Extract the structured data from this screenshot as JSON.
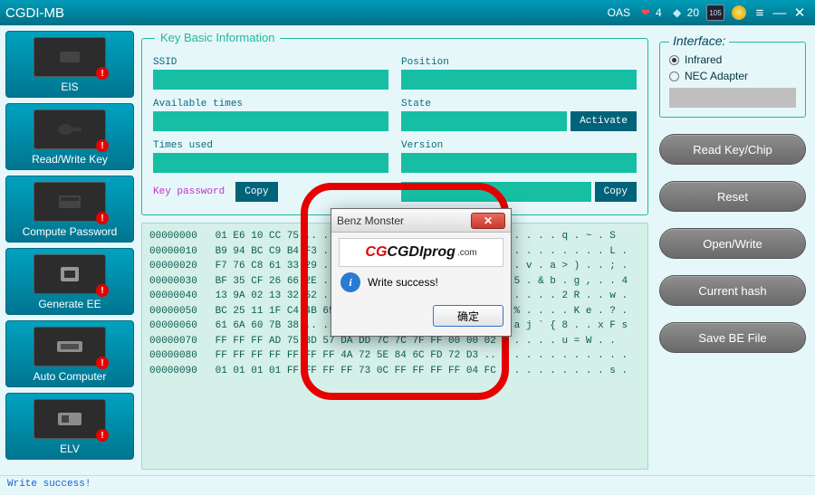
{
  "titlebar": {
    "app": "CGDI-MB",
    "oas": "OAS",
    "heart_count": "4",
    "diamond_count": "20",
    "chip_label": "105"
  },
  "sidebar": {
    "items": [
      {
        "label": "EIS"
      },
      {
        "label": "Read/Write Key"
      },
      {
        "label": "Compute Password"
      },
      {
        "label": "Generate EE"
      },
      {
        "label": "Auto Computer"
      },
      {
        "label": "ELV"
      }
    ]
  },
  "kbi": {
    "title": "Key Basic Information",
    "ssid_lbl": "SSID",
    "position_lbl": "Position",
    "avail_lbl": "Available times",
    "state_lbl": "State",
    "activate_btn": "Activate",
    "times_lbl": "Times used",
    "version_lbl": "Version",
    "keypw_lbl": "Key password",
    "copy_btn": "Copy"
  },
  "hex": {
    "lines": [
      "00000000   01 E6 10 CC 75 .. .. .. .. .. .. .. .. .. .. ..   . . . . q . ~ . S",
      "00000010   B9 94 BC C9 B4 F3 .. .. .. .. .. .. .. .. .. ..   . . . . . . . . L .",
      "00000020   F7 76 C8 61 33 29 .. .. .. .. .. .. .. .. .. ..   . v . a > ) . . ; .",
      "00000030   BF 35 CF 26 66 2E .. .. .. .. .. .. .. .. .. ..   5 . & b . g , . . 4",
      "00000040   13 9A 02 13 32 52 .. .. .. .. .. .. .. .. .. ..   . . . . 2 R . . w .",
      "00000050   BC 25 11 1F C4 4B 65 92 3F F8 B5 6D 1B 7C C4 06   % . . . . K e . ? .",
      "00000060   61 6A 60 7B 38 .. .. .. .. .. .. .. .. .. .. ..   a j ` { 8 . . x F s",
      "00000070   FF FF FF AD 75 3D 57 DA DD 7C 7C 7F FF 00 00 02   . . . . u = W . .",
      "00000080   FF FF FF FF FF FF FF 4A 72 5E 84 6C FD 72 D3 ..   . . . . . . . . . .",
      "00000090   01 01 01 01 FF FF FF FF 73 0C FF FF FF FF 04 FC   . . . . . . . . s ."
    ]
  },
  "right": {
    "iface_title": "Interface:",
    "radio_ir": "Infrared",
    "radio_nec": "NEC Adapter",
    "buttons": [
      "Read Key/Chip",
      "Reset",
      "Open/Write",
      "Current hash",
      "Save BE File"
    ]
  },
  "status": {
    "text": "Write success!"
  },
  "modal": {
    "title": "Benz Monster",
    "logo_cg": "CG",
    "logo_rest": "CGDIprog",
    "logo_dom": ".com",
    "message": "Write success!",
    "ok": "确定"
  }
}
